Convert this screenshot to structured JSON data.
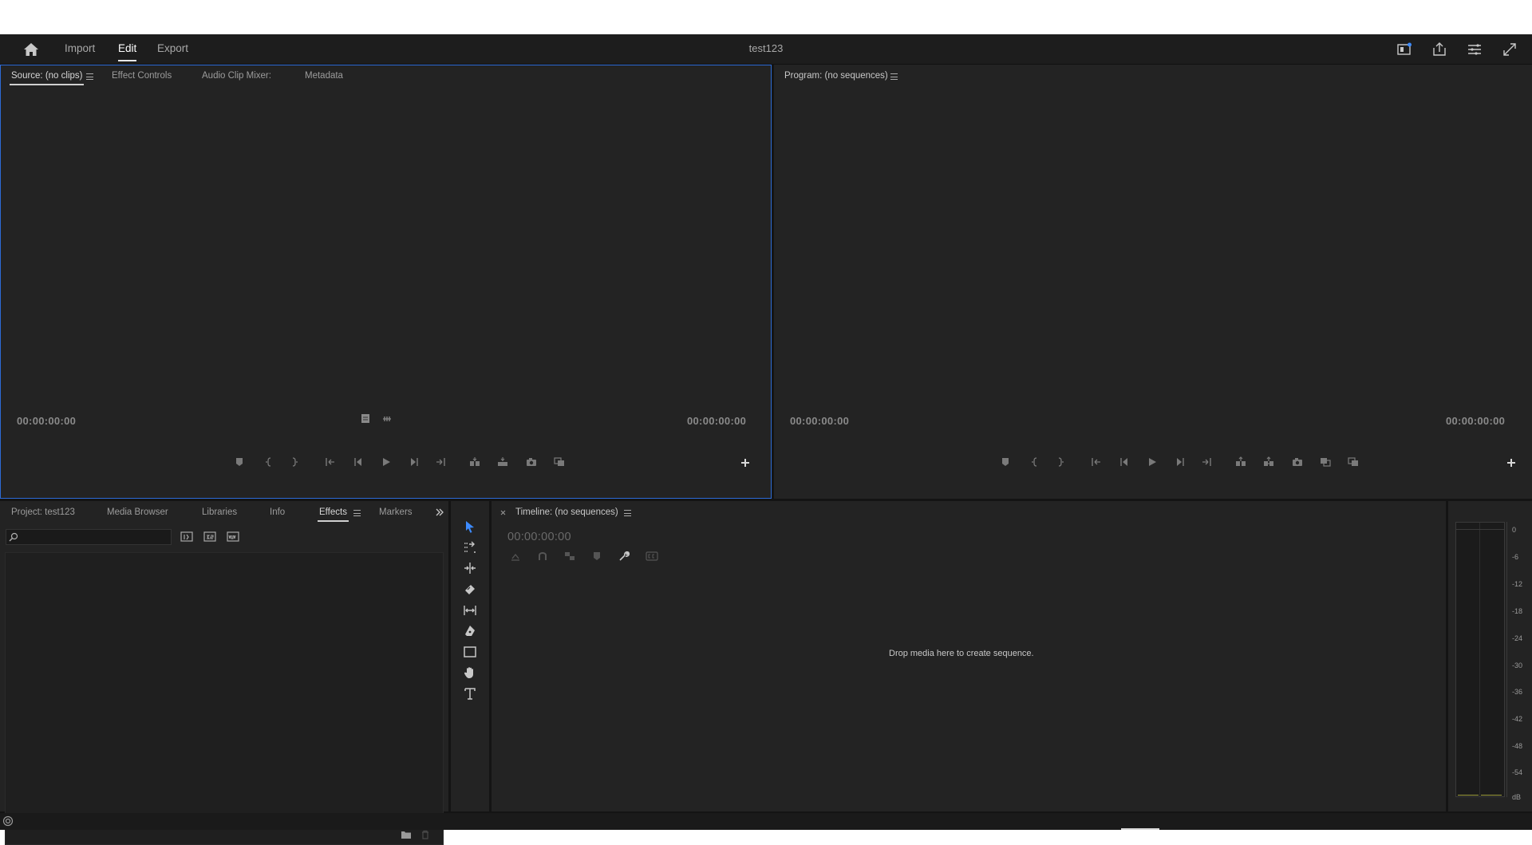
{
  "header": {
    "workspace_tabs": [
      "Import",
      "Edit",
      "Export"
    ],
    "active_tab": "Edit",
    "project_title": "test123"
  },
  "source_monitor": {
    "tabs": [
      "Source: (no clips)",
      "Effect Controls",
      "Audio Clip Mixer:",
      "Metadata"
    ],
    "timecode_left": "00:00:00:00",
    "timecode_right": "00:00:00:00"
  },
  "program_monitor": {
    "tab": "Program: (no sequences)",
    "timecode_left": "00:00:00:00",
    "timecode_right": "00:00:00:00"
  },
  "project_panel": {
    "tabs": [
      "Project: test123",
      "Media Browser",
      "Libraries",
      "Info",
      "Effects",
      "Markers"
    ],
    "active_tab": "Effects",
    "search_placeholder": ""
  },
  "timeline": {
    "tab": "Timeline: (no sequences)",
    "timecode": "00:00:00:00",
    "drop_message": "Drop media here to create sequence."
  },
  "audio_meter": {
    "scale": [
      "0",
      "-6",
      "-12",
      "-18",
      "-24",
      "-30",
      "-36",
      "-42",
      "-48",
      "-54",
      "dB"
    ]
  },
  "colors": {
    "focus_outline": "#2d6bd6",
    "selection_tool": "#3d8bff"
  }
}
